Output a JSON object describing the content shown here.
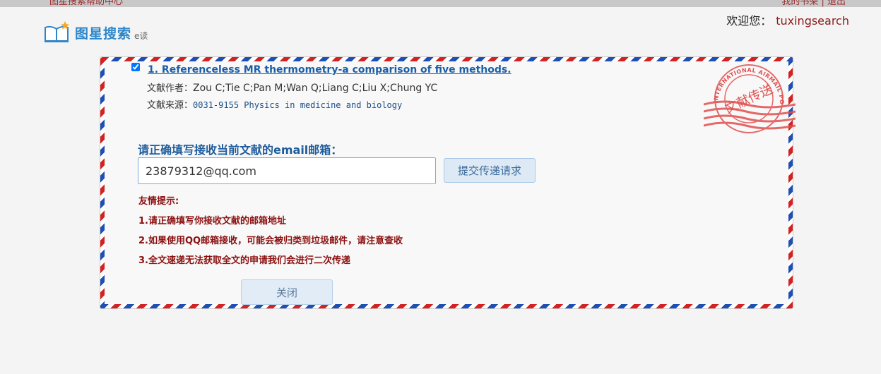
{
  "header": {
    "top_left_fragment": "图星搜索帮助中心",
    "top_right_fragment": "我的书架 | 退出",
    "welcome_label": "欢迎您：",
    "username": "tuxingsearch"
  },
  "logo": {
    "text": "图星搜索",
    "sub": "e读"
  },
  "stamp": {
    "center_text": "文献传送",
    "ring_text": "INTERNATIONAL AIRMAIL POST"
  },
  "article": {
    "checked": true,
    "title": "1. Referenceless MR thermometry-a comparison of five methods.",
    "authors_label": "文献作者：",
    "authors": "Zou C;Tie C;Pan M;Wan Q;Liang C;Liu X;Chung YC",
    "source_label": "文献来源：",
    "source": "0031-9155 Physics in medicine and biology"
  },
  "form": {
    "prompt": "请正确填写接收当前文献的email邮箱：",
    "email_value": "23879312@qq.com",
    "submit_label": "提交传递请求",
    "tips_title": "友情提示:",
    "tips": [
      "1.请正确填写你接收文献的邮箱地址",
      "2.如果使用QQ邮箱接收，可能会被归类到垃圾邮件，请注意查收",
      "3.全文速递无法获取全文的申请我们会进行二次传递"
    ],
    "close_label": "关闭"
  },
  "colors": {
    "stripe_red": "#d32222",
    "stripe_blue": "#1e4fb4",
    "stamp_red": "#e05050",
    "link_blue": "#1a5ea8",
    "tip_red": "#8b1010"
  }
}
